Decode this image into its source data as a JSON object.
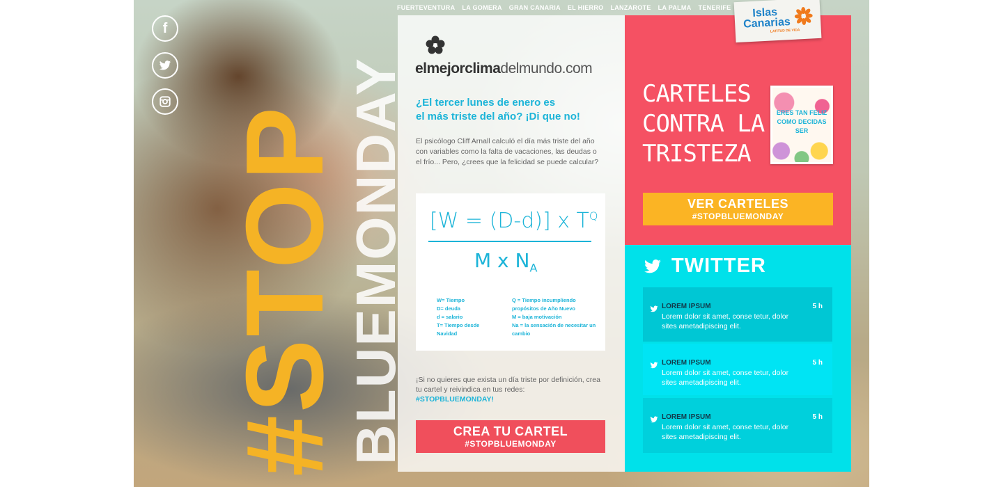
{
  "social": [
    {
      "name": "facebook-icon",
      "glyph": "f"
    },
    {
      "name": "twitter-icon",
      "glyph": ""
    },
    {
      "name": "instagram-icon",
      "glyph": ""
    }
  ],
  "hero": {
    "stop_text": "#STOP",
    "bluemonday_text": "BLUEMONDAY"
  },
  "topnav": [
    "FUERTEVENTURA",
    "LA GOMERA",
    "GRAN CANARIA",
    "EL HIERRO",
    "LANZAROTE",
    "LA PALMA",
    "TENERIFE"
  ],
  "brand": {
    "logo_prefix": "elmejor",
    "logo_bold": "clima",
    "logo_mid": "delmundo",
    "logo_suffix": ".com",
    "islas_name_1": "Islas",
    "islas_name_2": "Canarias",
    "islas_tagline": "LATITUD DE VIDA"
  },
  "center": {
    "headline_1": "¿El tercer lunes de enero es",
    "headline_2": "el más triste del año? ¡Di que no!",
    "intro": "El psicólogo Cliff Arnall calculó el día más triste del año con variables como la falta de vacaciones, las deudas o el frío... Pero, ¿crees que la felicidad se puede calcular?",
    "formula_top": "[W = (D-d)] x T",
    "formula_top_sup": "Q",
    "formula_bottom": "M x N",
    "formula_bottom_sub": "A",
    "legend_left": [
      "W= Tiempo",
      "D= deuda",
      "d = salario",
      "T= Tiempo desde Navidad"
    ],
    "legend_right": [
      "Q = Tiempo incumpliendo propósitos de Año Nuevo",
      "M = baja motivación",
      "Na = la sensación de necesitar un cambio"
    ],
    "cta_text": "¡Si no quieres que exista un día triste por definición, crea tu cartel y reivindica en tus redes:",
    "cta_tag": "#STOPBLUEMONDAY!",
    "crea_line1": "CREA TU CARTEL",
    "crea_line2": "#STOPBLUEMONDAY"
  },
  "carteles": {
    "title_1": "CARTELES",
    "title_2": "CONTRA LA",
    "title_3": "TRISTEZA",
    "poster_text": "ERES TAN FELIZ COMO DECIDAS SER",
    "ver_line1": "VER CARTELES",
    "ver_line2": "#STOPBLUEMONDAY"
  },
  "twitter": {
    "heading": "TWITTER",
    "tweets": [
      {
        "user": "LOREM IPSUM",
        "time": "5 h",
        "body": "Lorem dolor sit amet, conse tetur, dolor sites ametadipiscing elit."
      },
      {
        "user": "LOREM IPSUM",
        "time": "5 h",
        "body": "Lorem dolor sit amet, conse tetur, dolor sites ametadipiscing elit."
      },
      {
        "user": "LOREM IPSUM",
        "time": "5 h",
        "body": "Lorem dolor sit amet, conse tetur, dolor sites ametadipiscing elit."
      }
    ]
  },
  "colors": {
    "accent_yellow": "#fbb424",
    "accent_red": "#f55163",
    "accent_cyan": "#00e1ea",
    "text_blue": "#1cb4d8"
  }
}
